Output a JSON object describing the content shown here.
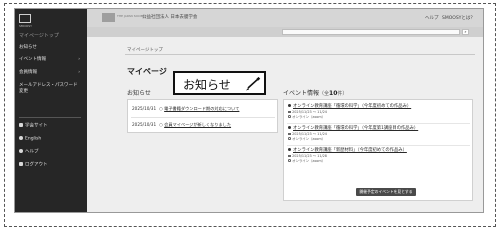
{
  "sidebar": {
    "logo_caption": "SMOOSY",
    "heading": "マイページトップ",
    "items": [
      {
        "label": "お知らせ"
      },
      {
        "label": "イベント情報",
        "chevron": "›"
      },
      {
        "label": "会員情報",
        "chevron": "›"
      },
      {
        "label": "メールアドレス・パスワード変更"
      },
      {
        "label": "学会サイト"
      },
      {
        "label": "English"
      },
      {
        "label": "ヘルプ"
      },
      {
        "label": "ログアウト"
      }
    ]
  },
  "header": {
    "brand_small": "THE JAPAN SOCIETY",
    "brand_name": "公益社団法人 日本去膜学会",
    "help_label": "ヘルプ",
    "about_label": "SMOOSYとは？",
    "search_icon_glyph": "⌕"
  },
  "breadcrumb": "マイページトップ",
  "page_title": "マイページ",
  "callout": {
    "text": "お知らせ",
    "icon": "pencil-icon"
  },
  "news": {
    "section_title": "お知らせ",
    "items": [
      {
        "date": "2025/10/31",
        "bullet": "○",
        "title": "電子書籍ダウンロード期の対応について"
      },
      {
        "date": "2025/10/31",
        "bullet": "○",
        "title": "会員マイページが新しくなりました"
      }
    ]
  },
  "events": {
    "section_title": "イベント情報",
    "count_prefix": "（全",
    "count": "10",
    "count_suffix": "件）",
    "items": [
      {
        "title": "オンライン教育講座「循環の科学」（今年度初めての作品み）",
        "date": "2025/11/23 〜 11/24",
        "location": "オンライン（zoom）"
      },
      {
        "title": "オンライン教育講座「循環の科学」（今年度第1講座目の作品み）",
        "date": "2025/11/23 〜 11/24",
        "location": "オンライン（zoom）"
      },
      {
        "title": "オンライン教育講座「新歴材料」（今年度初めての作品み）",
        "date": "2025/11/23 〜 11/28",
        "location": "オンライン（zoom）"
      }
    ],
    "more_label": "開催予定のイベントを見とする"
  }
}
